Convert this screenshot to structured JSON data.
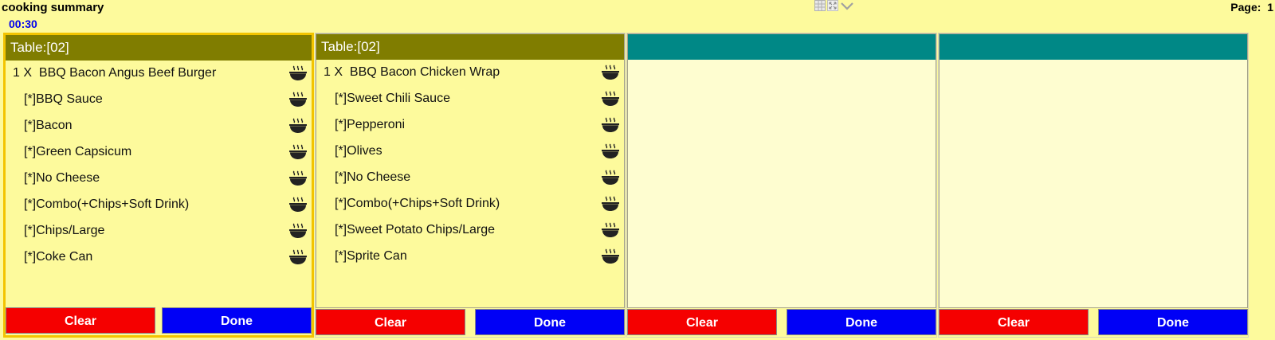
{
  "app": {
    "title": "cooking summary",
    "timer": "00:30",
    "page_label": "Page:  1"
  },
  "icons": {
    "item_status": "steaming-bowl-icon",
    "grid": "grid-view-icon",
    "fullscreen": "fullscreen-icon",
    "dropdown": "chevron-down-icon"
  },
  "colors": {
    "background": "#fdfa9c",
    "header_active": "#807d00",
    "header_empty": "#008886",
    "clear_button": "#f50000",
    "done_button": "#0000f6",
    "selected_border": "#f3c400"
  },
  "panels": [
    {
      "header": "Table:[02]",
      "clear_label": "Clear",
      "done_label": "Done",
      "items": [
        {
          "text": "1 X  BBQ Bacon Angus Beef Burger"
        },
        {
          "text": "[*]BBQ Sauce"
        },
        {
          "text": "[*]Bacon"
        },
        {
          "text": "[*]Green Capsicum"
        },
        {
          "text": "[*]No Cheese"
        },
        {
          "text": "[*]Combo(+Chips+Soft Drink)"
        },
        {
          "text": "[*]Chips/Large"
        },
        {
          "text": "[*]Coke Can"
        }
      ]
    },
    {
      "header": "Table:[02]",
      "clear_label": "Clear",
      "done_label": "Done",
      "items": [
        {
          "text": "1 X  BBQ Bacon Chicken Wrap"
        },
        {
          "text": "[*]Sweet Chili Sauce"
        },
        {
          "text": "[*]Pepperoni"
        },
        {
          "text": "[*]Olives"
        },
        {
          "text": "[*]No Cheese"
        },
        {
          "text": "[*]Combo(+Chips+Soft Drink)"
        },
        {
          "text": "[*]Sweet Potato Chips/Large"
        },
        {
          "text": "[*]Sprite Can"
        }
      ]
    },
    {
      "header": "",
      "clear_label": "Clear",
      "done_label": "Done",
      "items": []
    },
    {
      "header": "",
      "clear_label": "Clear",
      "done_label": "Done",
      "items": []
    }
  ]
}
